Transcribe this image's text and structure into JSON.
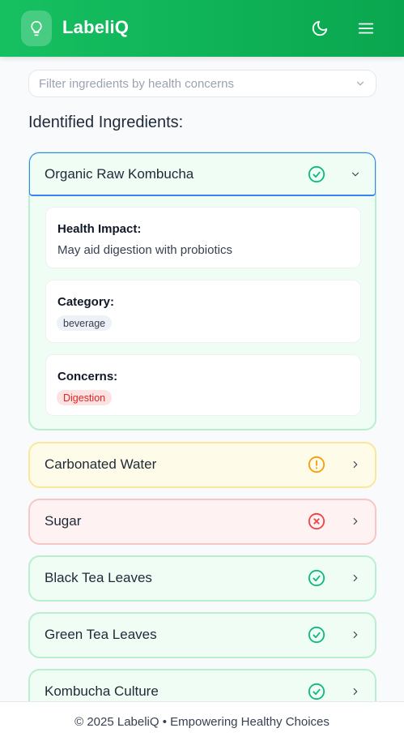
{
  "app": {
    "title": "LabeliQ"
  },
  "header": {
    "theme_icon": "moon-icon",
    "menu_icon": "hamburger-menu-icon"
  },
  "filter": {
    "placeholder": "Filter ingredients by health concerns"
  },
  "section": {
    "title": "Identified Ingredients:"
  },
  "ingredients": [
    {
      "name": "Organic Raw Kombucha",
      "status": "good",
      "expanded": true,
      "details": {
        "health_impact_label": "Health Impact:",
        "health_impact": "May aid digestion with probiotics",
        "category_label": "Category:",
        "category": "beverage",
        "concerns_label": "Concerns:",
        "concerns": [
          "Digestion"
        ]
      }
    },
    {
      "name": "Carbonated Water",
      "status": "warning",
      "expanded": false
    },
    {
      "name": "Sugar",
      "status": "bad",
      "expanded": false
    },
    {
      "name": "Black Tea Leaves",
      "status": "good",
      "expanded": false
    },
    {
      "name": "Green Tea Leaves",
      "status": "good",
      "expanded": false
    },
    {
      "name": "Kombucha Culture",
      "status": "good",
      "expanded": false
    }
  ],
  "colors": {
    "brand": "#16c061",
    "good": "#10b981",
    "warning": "#f59e0b",
    "bad": "#ef4444"
  },
  "footer": {
    "text": "© 2025 LabeliQ • Empowering Healthy Choices"
  }
}
